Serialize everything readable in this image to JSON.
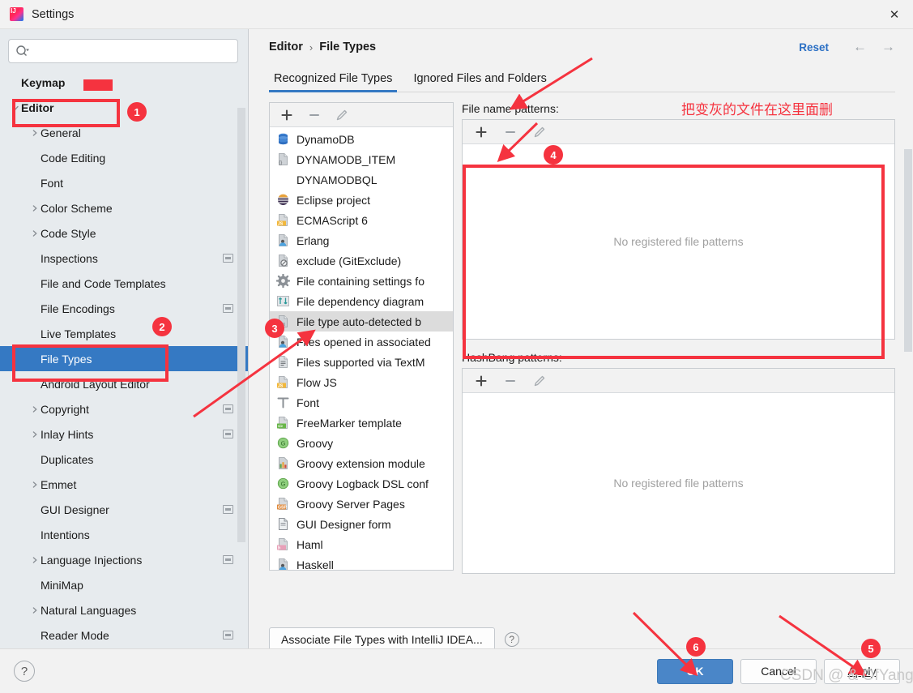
{
  "window": {
    "title": "Settings",
    "app_icon": "intellij-idea-icon",
    "close_label": "✕"
  },
  "search": {
    "value": "",
    "placeholder": "",
    "icon": "search-icon"
  },
  "sidebar": {
    "items": [
      {
        "label": "Keymap",
        "level": 0,
        "arrow": false,
        "bold": true,
        "selected": false,
        "badge": false
      },
      {
        "label": "Editor",
        "level": 0,
        "arrow": "down",
        "bold": true,
        "selected": false,
        "badge": false
      },
      {
        "label": "General",
        "level": 1,
        "arrow": "right",
        "bold": false,
        "selected": false,
        "badge": false
      },
      {
        "label": "Code Editing",
        "level": 1,
        "arrow": false,
        "bold": false,
        "selected": false,
        "badge": false
      },
      {
        "label": "Font",
        "level": 1,
        "arrow": false,
        "bold": false,
        "selected": false,
        "badge": false
      },
      {
        "label": "Color Scheme",
        "level": 1,
        "arrow": "right",
        "bold": false,
        "selected": false,
        "badge": false
      },
      {
        "label": "Code Style",
        "level": 1,
        "arrow": "right",
        "bold": false,
        "selected": false,
        "badge": false
      },
      {
        "label": "Inspections",
        "level": 1,
        "arrow": false,
        "bold": false,
        "selected": false,
        "badge": true
      },
      {
        "label": "File and Code Templates",
        "level": 1,
        "arrow": false,
        "bold": false,
        "selected": false,
        "badge": false
      },
      {
        "label": "File Encodings",
        "level": 1,
        "arrow": false,
        "bold": false,
        "selected": false,
        "badge": true
      },
      {
        "label": "Live Templates",
        "level": 1,
        "arrow": false,
        "bold": false,
        "selected": false,
        "badge": false
      },
      {
        "label": "File Types",
        "level": 1,
        "arrow": false,
        "bold": false,
        "selected": true,
        "badge": false
      },
      {
        "label": "Android Layout Editor",
        "level": 1,
        "arrow": false,
        "bold": false,
        "selected": false,
        "badge": false
      },
      {
        "label": "Copyright",
        "level": 1,
        "arrow": "right",
        "bold": false,
        "selected": false,
        "badge": true
      },
      {
        "label": "Inlay Hints",
        "level": 1,
        "arrow": "right",
        "bold": false,
        "selected": false,
        "badge": true
      },
      {
        "label": "Duplicates",
        "level": 1,
        "arrow": false,
        "bold": false,
        "selected": false,
        "badge": false
      },
      {
        "label": "Emmet",
        "level": 1,
        "arrow": "right",
        "bold": false,
        "selected": false,
        "badge": false
      },
      {
        "label": "GUI Designer",
        "level": 1,
        "arrow": false,
        "bold": false,
        "selected": false,
        "badge": true
      },
      {
        "label": "Intentions",
        "level": 1,
        "arrow": false,
        "bold": false,
        "selected": false,
        "badge": false
      },
      {
        "label": "Language Injections",
        "level": 1,
        "arrow": "right",
        "bold": false,
        "selected": false,
        "badge": true
      },
      {
        "label": "MiniMap",
        "level": 1,
        "arrow": false,
        "bold": false,
        "selected": false,
        "badge": false
      },
      {
        "label": "Natural Languages",
        "level": 1,
        "arrow": "right",
        "bold": false,
        "selected": false,
        "badge": false
      },
      {
        "label": "Reader Mode",
        "level": 1,
        "arrow": false,
        "bold": false,
        "selected": false,
        "badge": true
      }
    ]
  },
  "header": {
    "breadcrumb_parent": "Editor",
    "breadcrumb_sep": "›",
    "breadcrumb_current": "File Types",
    "reset_label": "Reset",
    "back_arrow": "←",
    "forward_arrow": "→"
  },
  "tabs": [
    {
      "label": "Recognized File Types",
      "active": true
    },
    {
      "label": "Ignored Files and Folders",
      "active": false
    }
  ],
  "file_types_panel": {
    "toolbar": {
      "add": "+",
      "remove": "–",
      "edit": "pencil-icon"
    },
    "items": [
      {
        "label": "DynamoDB",
        "icon": "db-cylinder-blue"
      },
      {
        "label": "DYNAMODB_ITEM",
        "icon": "doc-braces-gray"
      },
      {
        "label": "DYNAMODBQL",
        "icon": "none"
      },
      {
        "label": "Eclipse project",
        "icon": "eclipse-globe"
      },
      {
        "label": "ECMAScript 6",
        "icon": "doc-js-yellow"
      },
      {
        "label": "Erlang",
        "icon": "doc-person-blue"
      },
      {
        "label": "exclude (GitExclude)",
        "icon": "doc-forbidden-gray"
      },
      {
        "label": "File containing settings fo",
        "icon": "gear-gray"
      },
      {
        "label": "File dependency diagram",
        "icon": "arrows-updown-teal"
      },
      {
        "label": "File type auto-detected b",
        "icon": "doc-gray",
        "selected": true
      },
      {
        "label": "Files opened in associated",
        "icon": "doc-person-blue"
      },
      {
        "label": "Files supported via TextM",
        "icon": "doc-lines-gray"
      },
      {
        "label": "Flow JS",
        "icon": "doc-js-yellow"
      },
      {
        "label": "Font",
        "icon": "letter-t-gray"
      },
      {
        "label": "FreeMarker template",
        "icon": "doc-angle-green"
      },
      {
        "label": "Groovy",
        "icon": "circle-g-green"
      },
      {
        "label": "Groovy extension module",
        "icon": "chart-bars-icon"
      },
      {
        "label": "Groovy Logback DSL conf",
        "icon": "circle-g-green"
      },
      {
        "label": "Groovy Server Pages",
        "icon": "doc-gsp-orange"
      },
      {
        "label": "GUI Designer form",
        "icon": "doc-form-gray"
      },
      {
        "label": "Haml",
        "icon": "doc-haml-pink"
      },
      {
        "label": "Haskell",
        "icon": "doc-person-blue"
      }
    ]
  },
  "file_name_patterns": {
    "label": "File name patterns:",
    "toolbar": {
      "add": "+",
      "remove": "–",
      "edit": "pencil-icon"
    },
    "empty_text": "No registered file patterns"
  },
  "hashbang_patterns": {
    "label": "HashBang patterns:",
    "toolbar": {
      "add": "+",
      "remove": "–",
      "edit": "pencil-icon"
    },
    "empty_text": "No registered file patterns"
  },
  "bottom": {
    "associate_button": "Associate File Types with IntelliJ IDEA...",
    "inline_help": "?",
    "footer_help": "?",
    "ok_label": "OK",
    "cancel_label": "Cancel",
    "apply_label": "Apply"
  },
  "annotations": {
    "note_cn": "把变灰的文件在这里面删",
    "numbers": [
      "1",
      "2",
      "3",
      "4",
      "5",
      "6"
    ],
    "accent_color": "#f5333f"
  },
  "watermark": {
    "text": "CSDN @ & OfYang &"
  }
}
